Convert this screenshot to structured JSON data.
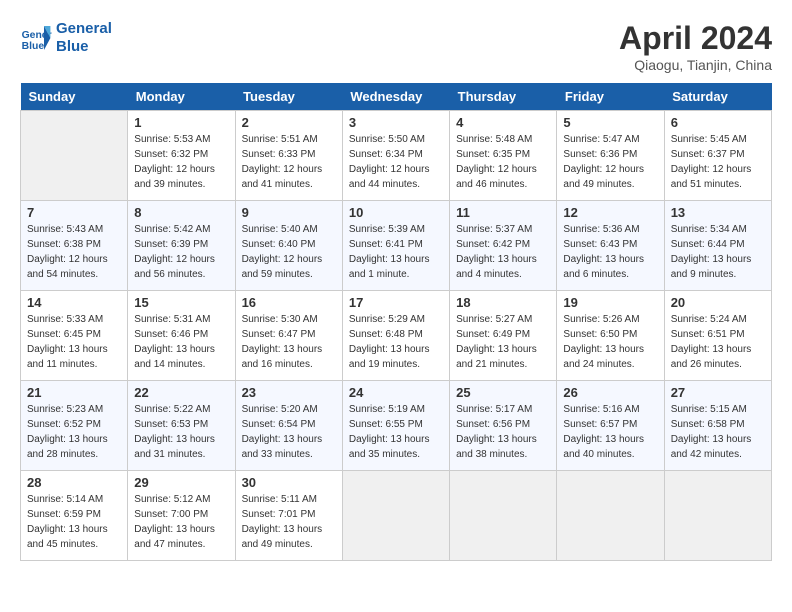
{
  "header": {
    "logo_line1": "General",
    "logo_line2": "Blue",
    "month": "April 2024",
    "location": "Qiaogu, Tianjin, China"
  },
  "days_of_week": [
    "Sunday",
    "Monday",
    "Tuesday",
    "Wednesday",
    "Thursday",
    "Friday",
    "Saturday"
  ],
  "weeks": [
    [
      {
        "day": null
      },
      {
        "day": "1",
        "sunrise": "5:53 AM",
        "sunset": "6:32 PM",
        "daylight": "12 hours and 39 minutes."
      },
      {
        "day": "2",
        "sunrise": "5:51 AM",
        "sunset": "6:33 PM",
        "daylight": "12 hours and 41 minutes."
      },
      {
        "day": "3",
        "sunrise": "5:50 AM",
        "sunset": "6:34 PM",
        "daylight": "12 hours and 44 minutes."
      },
      {
        "day": "4",
        "sunrise": "5:48 AM",
        "sunset": "6:35 PM",
        "daylight": "12 hours and 46 minutes."
      },
      {
        "day": "5",
        "sunrise": "5:47 AM",
        "sunset": "6:36 PM",
        "daylight": "12 hours and 49 minutes."
      },
      {
        "day": "6",
        "sunrise": "5:45 AM",
        "sunset": "6:37 PM",
        "daylight": "12 hours and 51 minutes."
      }
    ],
    [
      {
        "day": "7",
        "sunrise": "5:43 AM",
        "sunset": "6:38 PM",
        "daylight": "12 hours and 54 minutes."
      },
      {
        "day": "8",
        "sunrise": "5:42 AM",
        "sunset": "6:39 PM",
        "daylight": "12 hours and 56 minutes."
      },
      {
        "day": "9",
        "sunrise": "5:40 AM",
        "sunset": "6:40 PM",
        "daylight": "12 hours and 59 minutes."
      },
      {
        "day": "10",
        "sunrise": "5:39 AM",
        "sunset": "6:41 PM",
        "daylight": "13 hours and 1 minute."
      },
      {
        "day": "11",
        "sunrise": "5:37 AM",
        "sunset": "6:42 PM",
        "daylight": "13 hours and 4 minutes."
      },
      {
        "day": "12",
        "sunrise": "5:36 AM",
        "sunset": "6:43 PM",
        "daylight": "13 hours and 6 minutes."
      },
      {
        "day": "13",
        "sunrise": "5:34 AM",
        "sunset": "6:44 PM",
        "daylight": "13 hours and 9 minutes."
      }
    ],
    [
      {
        "day": "14",
        "sunrise": "5:33 AM",
        "sunset": "6:45 PM",
        "daylight": "13 hours and 11 minutes."
      },
      {
        "day": "15",
        "sunrise": "5:31 AM",
        "sunset": "6:46 PM",
        "daylight": "13 hours and 14 minutes."
      },
      {
        "day": "16",
        "sunrise": "5:30 AM",
        "sunset": "6:47 PM",
        "daylight": "13 hours and 16 minutes."
      },
      {
        "day": "17",
        "sunrise": "5:29 AM",
        "sunset": "6:48 PM",
        "daylight": "13 hours and 19 minutes."
      },
      {
        "day": "18",
        "sunrise": "5:27 AM",
        "sunset": "6:49 PM",
        "daylight": "13 hours and 21 minutes."
      },
      {
        "day": "19",
        "sunrise": "5:26 AM",
        "sunset": "6:50 PM",
        "daylight": "13 hours and 24 minutes."
      },
      {
        "day": "20",
        "sunrise": "5:24 AM",
        "sunset": "6:51 PM",
        "daylight": "13 hours and 26 minutes."
      }
    ],
    [
      {
        "day": "21",
        "sunrise": "5:23 AM",
        "sunset": "6:52 PM",
        "daylight": "13 hours and 28 minutes."
      },
      {
        "day": "22",
        "sunrise": "5:22 AM",
        "sunset": "6:53 PM",
        "daylight": "13 hours and 31 minutes."
      },
      {
        "day": "23",
        "sunrise": "5:20 AM",
        "sunset": "6:54 PM",
        "daylight": "13 hours and 33 minutes."
      },
      {
        "day": "24",
        "sunrise": "5:19 AM",
        "sunset": "6:55 PM",
        "daylight": "13 hours and 35 minutes."
      },
      {
        "day": "25",
        "sunrise": "5:17 AM",
        "sunset": "6:56 PM",
        "daylight": "13 hours and 38 minutes."
      },
      {
        "day": "26",
        "sunrise": "5:16 AM",
        "sunset": "6:57 PM",
        "daylight": "13 hours and 40 minutes."
      },
      {
        "day": "27",
        "sunrise": "5:15 AM",
        "sunset": "6:58 PM",
        "daylight": "13 hours and 42 minutes."
      }
    ],
    [
      {
        "day": "28",
        "sunrise": "5:14 AM",
        "sunset": "6:59 PM",
        "daylight": "13 hours and 45 minutes."
      },
      {
        "day": "29",
        "sunrise": "5:12 AM",
        "sunset": "7:00 PM",
        "daylight": "13 hours and 47 minutes."
      },
      {
        "day": "30",
        "sunrise": "5:11 AM",
        "sunset": "7:01 PM",
        "daylight": "13 hours and 49 minutes."
      },
      {
        "day": null
      },
      {
        "day": null
      },
      {
        "day": null
      },
      {
        "day": null
      }
    ]
  ]
}
